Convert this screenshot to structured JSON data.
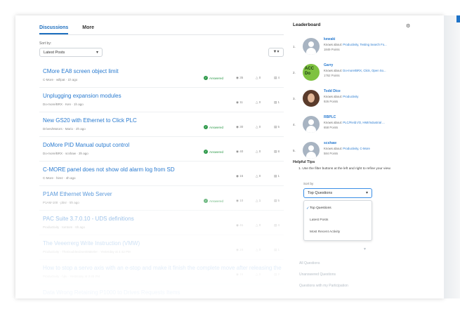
{
  "tabs": [
    {
      "label": "Discussions",
      "active": true
    },
    {
      "label": "More",
      "active": false
    }
  ],
  "sort": {
    "label": "Sort by:",
    "value": "Latest Posts"
  },
  "icons": {
    "filter": "filter-icon",
    "settings": "gear-icon",
    "views": "eye-icon",
    "likes": "thumbs-up-icon",
    "replies": "reply-icon",
    "check": "check-icon"
  },
  "colors": {
    "link": "#2a7bd0",
    "accent": "#1e6fbf",
    "answered": "#2f9a4b"
  },
  "threads": [
    {
      "title": "CMore EA8 screen object limit",
      "meta": "C-More · willpat · 1h ago",
      "answered": "Answered",
      "views": "35",
      "likes": "0",
      "replies": "4"
    },
    {
      "title": "Unplugging expansion modules",
      "meta": "Do-more/BRX · Ken · 1h ago",
      "answered": "",
      "views": "11",
      "likes": "0",
      "replies": "1"
    },
    {
      "title": "New GS20 with Ethernet to Click PLC",
      "meta": "Drives/Motors · Mario · 2h ago",
      "answered": "Answered",
      "views": "30",
      "likes": "0",
      "replies": "5"
    },
    {
      "title": "DoMore PID Manual output control",
      "meta": "Do-more/BRX · scshaw · 3h ago",
      "answered": "Answered",
      "views": "40",
      "likes": "0",
      "replies": "8"
    },
    {
      "title": "C-MORE panel does not show old alarm log from SD",
      "meta": "C-More · hirez · 4h ago",
      "answered": "",
      "views": "15",
      "likes": "0",
      "replies": "1"
    },
    {
      "title": "P1AM  Ethernet Web Server",
      "meta": "P1AM-100 · pbsr · 5h ago",
      "answered": "Answered",
      "views": "10",
      "likes": "1",
      "replies": "5"
    },
    {
      "title": "PAC Suite 3.7.0.10 - UDS definitions",
      "meta": "Productivity · tomtom · 6h ago",
      "answered": "",
      "views": "41",
      "likes": "0",
      "replies": "4"
    },
    {
      "title": "The Veeerrerg Write Instruction (VMW)",
      "meta": "Productivity · TheDoublesDoesMakeler · Yesterday at 4:42 PM",
      "answered": "",
      "views": "24",
      "likes": "0",
      "replies": "1"
    },
    {
      "title": "How to stop a servo axis with an e-stop and make it finish the complete move after releasing the e-stop?",
      "meta": "Productivity · hjtu · Yesterday at 3:45 PM",
      "answered": "",
      "views": "16",
      "likes": "0",
      "replies": "2"
    },
    {
      "title": "Data Wrong Retaining P1000 to Drives Requests Items",
      "meta": "",
      "answered": "",
      "views": "",
      "likes": "",
      "replies": ""
    }
  ],
  "leaderboard": {
    "title": "Leaderboard",
    "knows_prefix": "Knows about:",
    "entries": [
      {
        "rank": "1.",
        "name": "kewaki",
        "knows": "Productivity, Testing Search Fo...",
        "points": "1849 Points",
        "avatar": "default"
      },
      {
        "rank": "2.",
        "name": "Garry",
        "knows": "Do-more/BRX, Click, Open So...",
        "points": "1762 Points",
        "avatar": "acc",
        "initials": "ACC Do"
      },
      {
        "rank": "3.",
        "name": "Todd Dice",
        "knows": "Productivity",
        "points": "926 Points",
        "avatar": "photo"
      },
      {
        "rank": "4.",
        "name": "RBPLC",
        "knows": "PLC/Field I/O, HMI/Industrial ...",
        "points": "658 Points",
        "avatar": "default"
      },
      {
        "rank": "5.",
        "name": "scshaw",
        "knows": "Productivity, C-More",
        "points": "584 Points",
        "avatar": "default"
      }
    ]
  },
  "helpful_tips": {
    "title": "Helpful Tips",
    "text": "1. Use the filter buttons at the left and right to refine your view.",
    "sort_label": "Sort by",
    "select_value": "Top Questions",
    "options": [
      "Top Questions",
      "Latest Posts",
      "Most Recent Activity"
    ],
    "ghost_options": [
      "All Questions",
      "Unanswered Questions",
      "Questions with my Participation"
    ]
  }
}
